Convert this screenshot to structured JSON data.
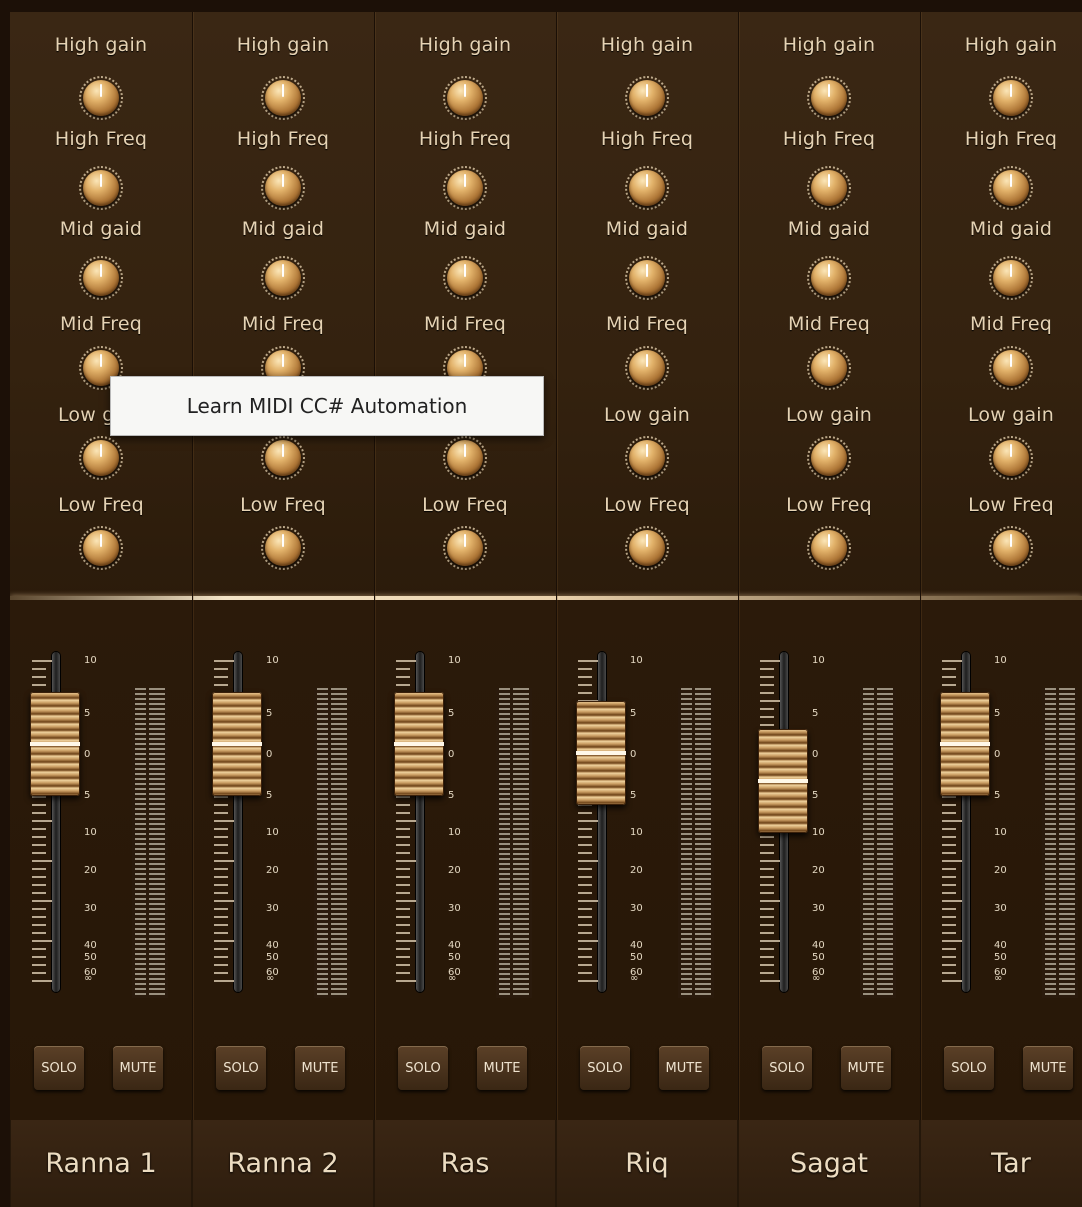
{
  "eq_labels": [
    "High gain",
    "High Freq",
    "Mid gaid",
    "Mid Freq",
    "Low gain",
    "Low Freq"
  ],
  "scale_labels": [
    "10",
    "5",
    "0",
    "5",
    "10",
    "20",
    "30",
    "40",
    "50",
    "60",
    "∞"
  ],
  "channels": [
    {
      "name": "Ranna 1",
      "solo": "SOLO",
      "mute": "MUTE",
      "fader_db": 0
    },
    {
      "name": "Ranna 2",
      "solo": "SOLO",
      "mute": "MUTE",
      "fader_db": 0
    },
    {
      "name": "Ras",
      "solo": "SOLO",
      "mute": "MUTE",
      "fader_db": 0
    },
    {
      "name": "Riq",
      "solo": "SOLO",
      "mute": "MUTE",
      "fader_db": -1
    },
    {
      "name": "Sagat",
      "solo": "SOLO",
      "mute": "MUTE",
      "fader_db": -4
    },
    {
      "name": "Tar",
      "solo": "SOLO",
      "mute": "MUTE",
      "fader_db": 0
    }
  ],
  "tooltip": {
    "text": "Learn MIDI CC# Automation"
  },
  "colors": {
    "accent": "#d9a65e",
    "panel": "#2a1a0c",
    "text": "#e6d3b4"
  }
}
